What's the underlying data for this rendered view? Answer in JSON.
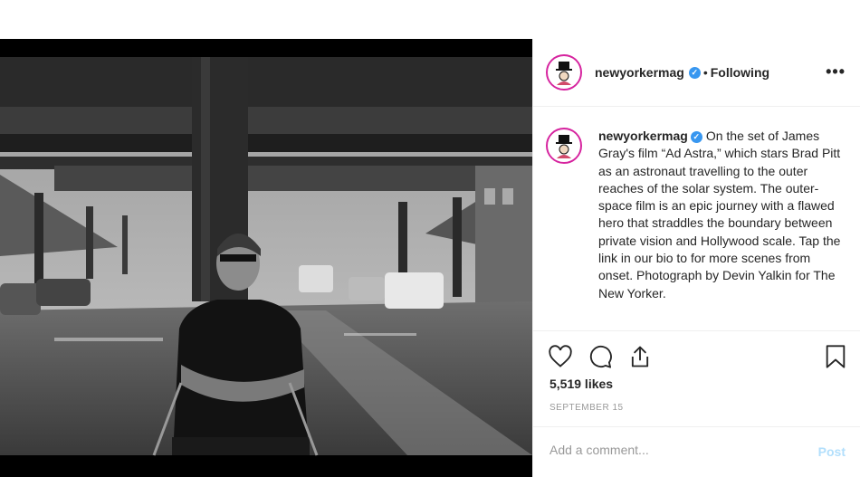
{
  "post": {
    "username": "newyorkermag",
    "separator": "•",
    "follow_status": "Following",
    "more_label": "•••",
    "verified_glyph": "✓",
    "caption": "On the set of James Gray's film “Ad Astra,” which stars Brad Pitt as an astronaut travelling to the outer reaches of the solar system. The outer-space film is an epic journey with a flawed hero that straddles the boundary between private vision and Hollywood scale. Tap the link in our bio to for more scenes from onset. Photograph by Devin Yalkin for The New Yorker.",
    "likes": "5,519 likes",
    "date": "SEPTEMBER 15"
  },
  "comment": {
    "placeholder": "Add a comment...",
    "post_label": "Post"
  },
  "icons": {
    "like": "heart-icon",
    "comment": "comment-icon",
    "share": "share-icon",
    "save": "bookmark-icon",
    "avatar": "newyorker-logo"
  },
  "colors": {
    "verified": "#3897f0",
    "post_disabled": "#b2dffc",
    "avatar_ring": "#d6249f"
  }
}
